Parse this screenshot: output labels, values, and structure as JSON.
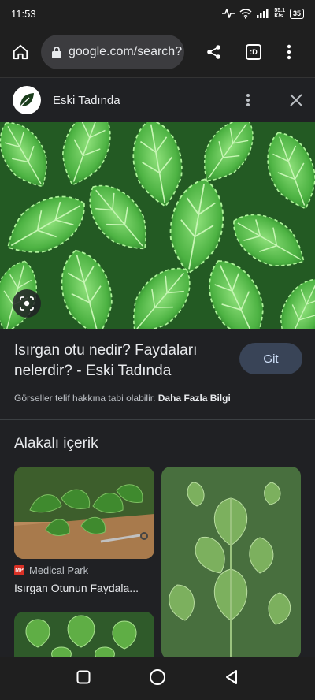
{
  "status_bar": {
    "time": "11:53",
    "speed": "55.1\nK/s",
    "battery": "35"
  },
  "browser": {
    "url": "google.com/search?",
    "tabs_label": ":D"
  },
  "panel": {
    "site_name": "Eski Tadında"
  },
  "result": {
    "title": "Isırgan otu nedir? Faydaları nelerdir? - Eski Tadında",
    "go_button": "Git",
    "copyright_text": "Görseller telif hakkına tabi olabilir.",
    "more_info": "Daha Fazla Bilgi"
  },
  "related": {
    "heading": "Alakalı içerik",
    "cards": [
      {
        "source": "Medical Park",
        "source_badge": "MP",
        "title": "Isırgan Otunun Faydala..."
      }
    ]
  },
  "colors": {
    "background": "#202124",
    "accent": "#394457",
    "leaf": "#4caf3a"
  }
}
